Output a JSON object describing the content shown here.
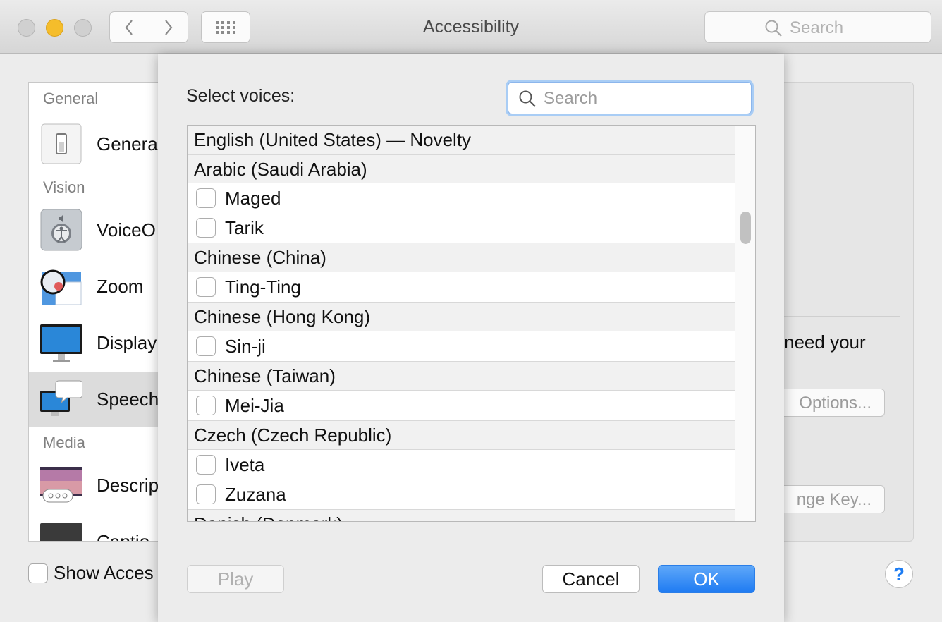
{
  "window": {
    "title": "Accessibility",
    "search_placeholder": "Search",
    "back_icon": "chevron-left-icon",
    "forward_icon": "chevron-right-icon",
    "grid_icon": "show-all-grid-icon"
  },
  "sidebar": {
    "sections": [
      {
        "label": "General"
      },
      {
        "label": "Vision"
      },
      {
        "label": "Media"
      }
    ],
    "items": [
      {
        "label": "Genera",
        "icon": "general-switch-icon"
      },
      {
        "label": "VoiceO",
        "icon": "voiceover-icon"
      },
      {
        "label": "Zoom",
        "icon": "zoom-icon"
      },
      {
        "label": "Display",
        "icon": "display-icon"
      },
      {
        "label": "Speech",
        "icon": "speech-icon",
        "selected": true
      },
      {
        "label": "Descrip",
        "icon": "descriptions-icon"
      },
      {
        "label": "Captio",
        "icon": "captions-icon"
      }
    ]
  },
  "background": {
    "text": "need your",
    "options_button": "Options...",
    "change_key_button": "nge Key...",
    "show_accessibility": "Show Acces",
    "help": "?"
  },
  "sheet": {
    "title": "Select voices:",
    "search_placeholder": "Search",
    "rows": [
      {
        "type": "group",
        "label": "English (United States) — Novelty"
      },
      {
        "type": "group",
        "label": "Arabic (Saudi Arabia)"
      },
      {
        "type": "voice",
        "label": "Maged",
        "checked": false
      },
      {
        "type": "voice",
        "label": "Tarik",
        "checked": false
      },
      {
        "type": "group",
        "label": "Chinese (China)"
      },
      {
        "type": "voice",
        "label": "Ting-Ting",
        "checked": false
      },
      {
        "type": "group",
        "label": "Chinese (Hong Kong)"
      },
      {
        "type": "voice",
        "label": "Sin-ji",
        "checked": false
      },
      {
        "type": "group",
        "label": "Chinese (Taiwan)"
      },
      {
        "type": "voice",
        "label": "Mei-Jia",
        "checked": false
      },
      {
        "type": "group",
        "label": "Czech (Czech Republic)"
      },
      {
        "type": "voice",
        "label": "Iveta",
        "checked": false
      },
      {
        "type": "voice",
        "label": "Zuzana",
        "checked": false
      },
      {
        "type": "group",
        "label": "Danish (Denmark)"
      }
    ],
    "play_button": "Play",
    "cancel_button": "Cancel",
    "ok_button": "OK",
    "accent_color": "#1f7bf2"
  }
}
